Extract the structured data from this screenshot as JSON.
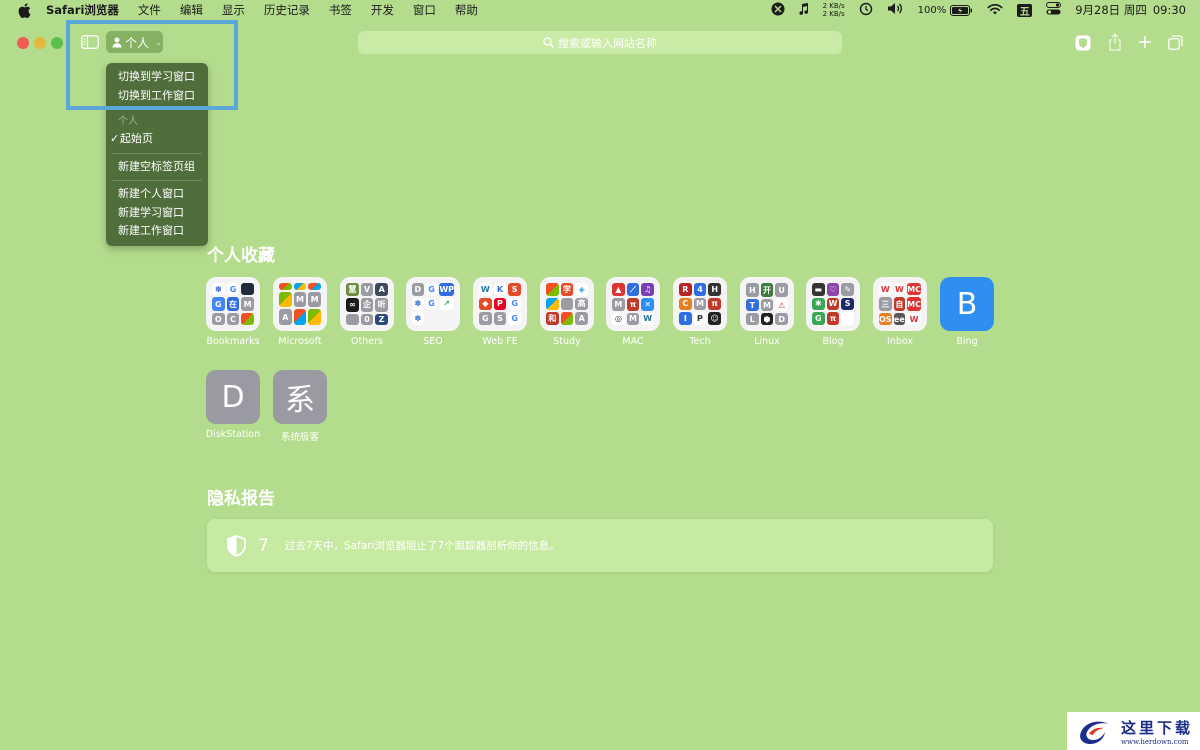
{
  "menubar": {
    "app_name": "Safari浏览器",
    "items": [
      "文件",
      "编辑",
      "显示",
      "历史记录",
      "书签",
      "开发",
      "窗口",
      "帮助"
    ],
    "net_up": "2 KB/s",
    "net_down": "2 KB/s",
    "battery": "100%",
    "input_method": "五",
    "date": "9月28日 周四",
    "time": "09:30"
  },
  "toolbar": {
    "profile_label": "个人",
    "search_placeholder": "搜索或输入网站名称"
  },
  "profile_menu": {
    "switch_items": [
      "切换到学习窗口",
      "切换到工作窗口"
    ],
    "section_header": "个人",
    "checked_item": "起始页",
    "new_tab_group": "新建空标签页组",
    "new_window_items": [
      "新建个人窗口",
      "新建学习窗口",
      "新建工作窗口"
    ]
  },
  "favorites": {
    "title": "个人收藏",
    "items": [
      {
        "name": "Bookmarks"
      },
      {
        "name": "Microsoft"
      },
      {
        "name": "Others"
      },
      {
        "name": "SEO"
      },
      {
        "name": "Web FE"
      },
      {
        "name": "Study"
      },
      {
        "name": "MAC"
      },
      {
        "name": "Tech"
      },
      {
        "name": "Linux"
      },
      {
        "name": "Blog"
      },
      {
        "name": "Inbox"
      },
      {
        "name": "Bing",
        "letter": "B",
        "color": "#2e8ff0"
      },
      {
        "name": "DiskStation",
        "letter": "D",
        "color": "#9a9aa2"
      },
      {
        "name": "系统极客",
        "letter": "系",
        "color": "#9a9aa2"
      }
    ]
  },
  "privacy": {
    "title": "隐私报告",
    "count": "7",
    "text": "过去7天中，Safari浏览器阻止了7个跟踪器剖析你的信息。"
  },
  "watermark": {
    "title": "这里下载",
    "url": "www.herdown.com"
  }
}
